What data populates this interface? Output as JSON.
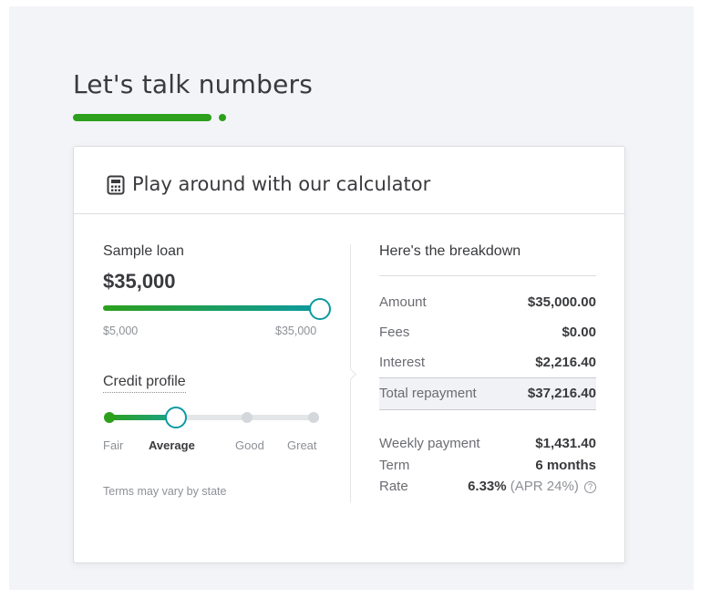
{
  "page": {
    "heading": "Let's talk numbers"
  },
  "card": {
    "title": "Play around with our calculator",
    "icon": "calculator-icon"
  },
  "loan": {
    "label": "Sample loan",
    "amount": "$35,000",
    "min_label": "$5,000",
    "max_label": "$35,000",
    "slider_fraction": 1.0
  },
  "credit": {
    "label": "Credit profile",
    "options": [
      "Fair",
      "Average",
      "Good",
      "Great"
    ],
    "selected": "Average",
    "note": "Terms may vary by state"
  },
  "breakdown": {
    "title": "Here's the breakdown",
    "rows": [
      {
        "label": "Amount",
        "value": "$35,000.00"
      },
      {
        "label": "Fees",
        "value": "$0.00"
      },
      {
        "label": "Interest",
        "value": "$2,216.40"
      },
      {
        "label": "Total repayment",
        "value": "$37,216.40"
      }
    ],
    "weekly_label": "Weekly payment",
    "weekly_value": "$1,431.40",
    "term_label": "Term",
    "term_value": "6 months",
    "rate_label": "Rate",
    "rate_value": "6.33%",
    "apr": "(APR 24%)",
    "help_icon": "?"
  },
  "colors": {
    "brand_green": "#2ca01c",
    "teal": "#0d9aa0",
    "background": "#f3f4f7"
  }
}
